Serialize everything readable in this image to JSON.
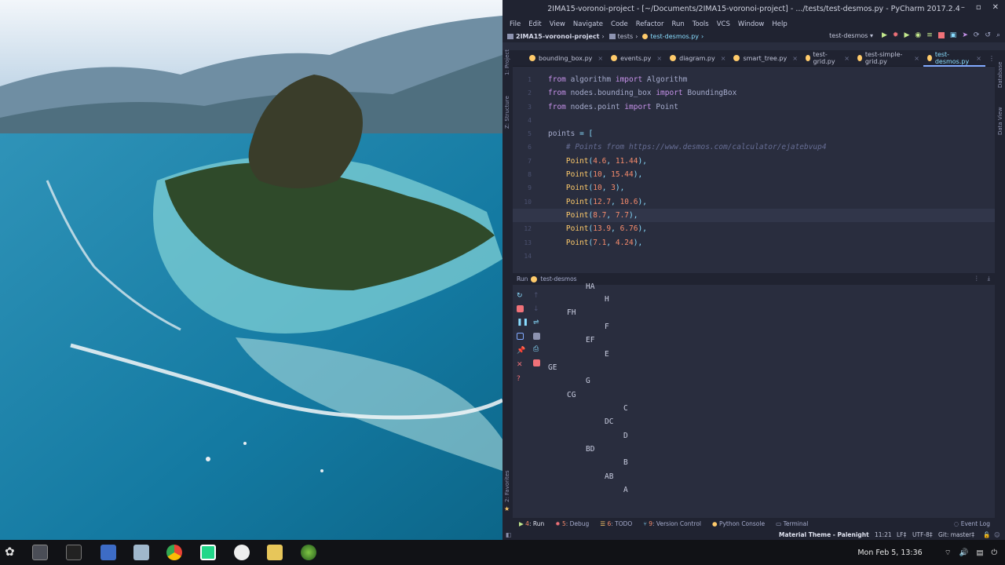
{
  "window": {
    "title": "2IMA15-voronoi-project - [~/Documents/2IMA15-voronoi-project] - .../tests/test-desmos.py - PyCharm 2017.2.4",
    "min": "–",
    "max": "▫",
    "close": "✕"
  },
  "menu": [
    "File",
    "Edit",
    "View",
    "Navigate",
    "Code",
    "Refactor",
    "Run",
    "Tools",
    "VCS",
    "Window",
    "Help"
  ],
  "nav": {
    "project": "2IMA15-voronoi-project",
    "folder": "tests",
    "file": "test-desmos.py",
    "run_config": "test-desmos ▾"
  },
  "side": {
    "project": "1: Project",
    "structure": "Z: Structure",
    "favorites": "2: Favorites",
    "database": "Database",
    "dataview": "Data View"
  },
  "tabs": [
    {
      "label": "bounding_box.py",
      "close": "×"
    },
    {
      "label": "events.py",
      "close": "×"
    },
    {
      "label": "diagram.py",
      "close": "×"
    },
    {
      "label": "smart_tree.py",
      "close": "×"
    },
    {
      "label": "test-grid.py",
      "close": "×"
    },
    {
      "label": "test-simple-grid.py",
      "close": "×"
    },
    {
      "label": "test-desmos.py",
      "close": "×"
    }
  ],
  "tabs_more": "⋮",
  "code": {
    "line_numbers": [
      "1",
      "2",
      "3",
      "4",
      "5",
      "6",
      "7",
      "8",
      "9",
      "10",
      "11",
      "12",
      "13",
      "14"
    ],
    "l1": [
      "from",
      "algorithm",
      "import",
      "Algorithm"
    ],
    "l2": [
      "from",
      "nodes.bounding_box",
      "import",
      "BoundingBox"
    ],
    "l3": [
      "from",
      "nodes.point",
      "import",
      "Point"
    ],
    "l5": [
      "points",
      "=",
      "["
    ],
    "comment": "# Points from https://www.desmos.com/calculator/ejatebvup4",
    "points": [
      [
        "4.6",
        "11.44"
      ],
      [
        "10",
        "15.44"
      ],
      [
        "10",
        "3"
      ],
      [
        "12.7",
        "10.6"
      ],
      [
        "8.7",
        "7.7"
      ],
      [
        "13.9",
        "6.76"
      ],
      [
        "7.1",
        "4.24"
      ]
    ],
    "ctor": "Point"
  },
  "run": {
    "label": "Run",
    "config": "test-desmos",
    "output": [
      "HA",
      "H",
      "FH",
      "F",
      "EF",
      "E",
      "GE",
      "G",
      "CG",
      "C",
      "DC",
      "D",
      "BD",
      "B",
      "AB",
      "A"
    ]
  },
  "bottom": {
    "run": "Run",
    "run_n": "4",
    "debug": "Debug",
    "debug_n": "5",
    "todo": "TODO",
    "todo_n": "6",
    "vc": "Version Control",
    "vc_n": "9",
    "console": "Python Console",
    "terminal": "Terminal",
    "eventlog": "Event Log"
  },
  "status": {
    "theme": "Material Theme - Palenight",
    "pos": "11:21",
    "lf": "LF‡",
    "enc": "UTF-8‡",
    "git": "Git: master‡"
  },
  "taskbar": {
    "clock": "Mon Feb  5, 13:36"
  },
  "colors": {
    "accent": "#82aaff",
    "bg": "#292d3e"
  }
}
